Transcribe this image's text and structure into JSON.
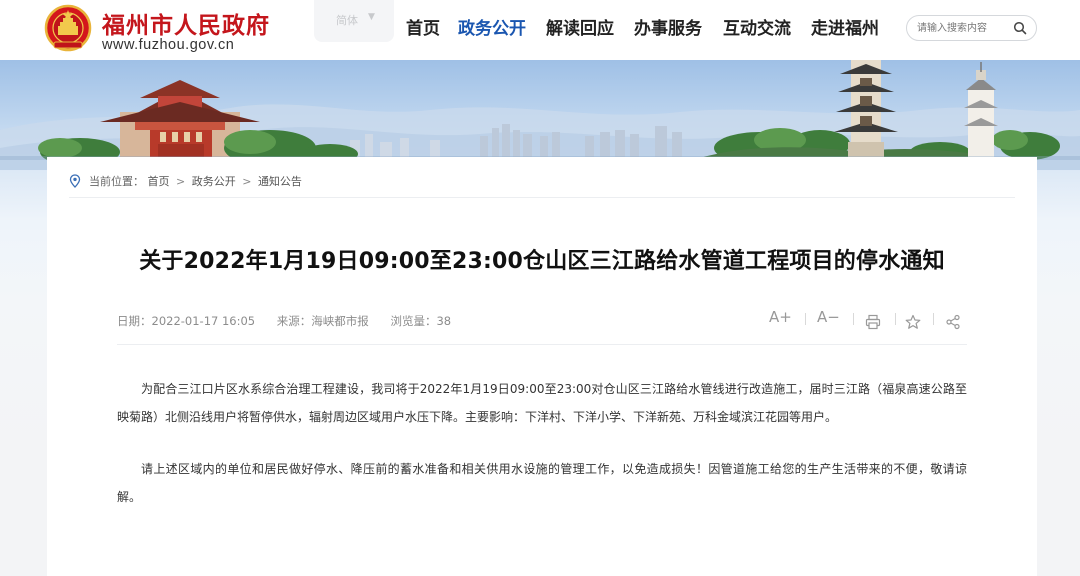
{
  "site": {
    "name": "福州市人民政府",
    "url": "www.fuzhou.gov.cn",
    "emblem": "national-emblem-icon"
  },
  "lang_selector": {
    "value": "简体"
  },
  "nav": {
    "items": [
      {
        "label": "首页",
        "active": false
      },
      {
        "label": "政务公开",
        "active": true
      },
      {
        "label": "解读回应",
        "active": false
      },
      {
        "label": "办事服务",
        "active": false
      },
      {
        "label": "互动交流",
        "active": false
      },
      {
        "label": "走进福州",
        "active": false
      }
    ],
    "active_color": "#1a56b0"
  },
  "search": {
    "placeholder": "请输入搜索内容",
    "icon": "search-icon"
  },
  "breadcrumb": {
    "label": "当前位置：",
    "items": [
      "首页",
      "政务公开",
      "通知公告"
    ],
    "separator": ">",
    "icon": "location-pin-icon"
  },
  "article": {
    "title": "关于2022年1月19日09:00至23:00仓山区三江路给水管道工程项目的停水通知",
    "meta": {
      "date": "日期：2022-01-17 16:05",
      "source": "来源：海峡都市报",
      "views": "浏览量：38"
    },
    "tools": {
      "font_increase": "A+",
      "font_decrease": "A−",
      "print_icon": "print-icon",
      "favorite_icon": "star-icon",
      "share_icon": "share-icon"
    },
    "paragraphs": [
      "为配合三江口片区水系综合治理工程建设，我司将于2022年1月19日09:00至23:00对仓山区三江路给水管线进行改造施工，届时三江路（福泉高速公路至映菊路）北侧沿线用户将暂停供水，辐射周边区域用户水压下降。主要影响：下洋村、下洋小学、下洋新苑、万科金域滨江花园等用户。",
      "请上述区域内的单位和居民做好停水、降压前的蓄水准备和相关供用水设施的管理工作，以免造成损失！因管道施工给您的生产生活带来的不便，敬请谅解。"
    ]
  },
  "colors": {
    "brand_red": "#c4161c",
    "nav_active": "#1a56b0",
    "text_dark": "#111111",
    "meta_gray": "#8c8c8c"
  }
}
